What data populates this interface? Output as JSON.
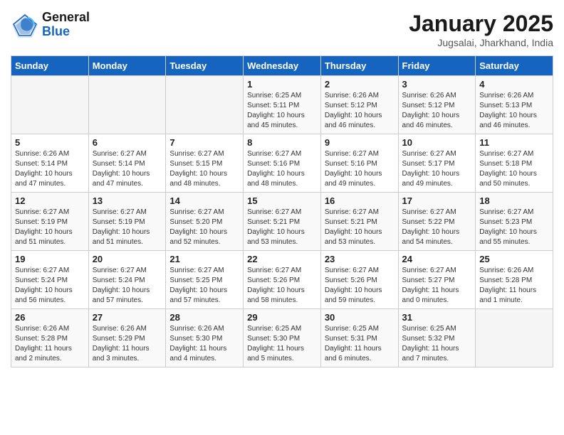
{
  "header": {
    "logo_line1": "General",
    "logo_line2": "Blue",
    "month": "January 2025",
    "location": "Jugsalai, Jharkhand, India"
  },
  "weekdays": [
    "Sunday",
    "Monday",
    "Tuesday",
    "Wednesday",
    "Thursday",
    "Friday",
    "Saturday"
  ],
  "weeks": [
    [
      {
        "day": "",
        "info": ""
      },
      {
        "day": "",
        "info": ""
      },
      {
        "day": "",
        "info": ""
      },
      {
        "day": "1",
        "info": "Sunrise: 6:25 AM\nSunset: 5:11 PM\nDaylight: 10 hours\nand 45 minutes."
      },
      {
        "day": "2",
        "info": "Sunrise: 6:26 AM\nSunset: 5:12 PM\nDaylight: 10 hours\nand 46 minutes."
      },
      {
        "day": "3",
        "info": "Sunrise: 6:26 AM\nSunset: 5:12 PM\nDaylight: 10 hours\nand 46 minutes."
      },
      {
        "day": "4",
        "info": "Sunrise: 6:26 AM\nSunset: 5:13 PM\nDaylight: 10 hours\nand 46 minutes."
      }
    ],
    [
      {
        "day": "5",
        "info": "Sunrise: 6:26 AM\nSunset: 5:14 PM\nDaylight: 10 hours\nand 47 minutes."
      },
      {
        "day": "6",
        "info": "Sunrise: 6:27 AM\nSunset: 5:14 PM\nDaylight: 10 hours\nand 47 minutes."
      },
      {
        "day": "7",
        "info": "Sunrise: 6:27 AM\nSunset: 5:15 PM\nDaylight: 10 hours\nand 48 minutes."
      },
      {
        "day": "8",
        "info": "Sunrise: 6:27 AM\nSunset: 5:16 PM\nDaylight: 10 hours\nand 48 minutes."
      },
      {
        "day": "9",
        "info": "Sunrise: 6:27 AM\nSunset: 5:16 PM\nDaylight: 10 hours\nand 49 minutes."
      },
      {
        "day": "10",
        "info": "Sunrise: 6:27 AM\nSunset: 5:17 PM\nDaylight: 10 hours\nand 49 minutes."
      },
      {
        "day": "11",
        "info": "Sunrise: 6:27 AM\nSunset: 5:18 PM\nDaylight: 10 hours\nand 50 minutes."
      }
    ],
    [
      {
        "day": "12",
        "info": "Sunrise: 6:27 AM\nSunset: 5:19 PM\nDaylight: 10 hours\nand 51 minutes."
      },
      {
        "day": "13",
        "info": "Sunrise: 6:27 AM\nSunset: 5:19 PM\nDaylight: 10 hours\nand 51 minutes."
      },
      {
        "day": "14",
        "info": "Sunrise: 6:27 AM\nSunset: 5:20 PM\nDaylight: 10 hours\nand 52 minutes."
      },
      {
        "day": "15",
        "info": "Sunrise: 6:27 AM\nSunset: 5:21 PM\nDaylight: 10 hours\nand 53 minutes."
      },
      {
        "day": "16",
        "info": "Sunrise: 6:27 AM\nSunset: 5:21 PM\nDaylight: 10 hours\nand 53 minutes."
      },
      {
        "day": "17",
        "info": "Sunrise: 6:27 AM\nSunset: 5:22 PM\nDaylight: 10 hours\nand 54 minutes."
      },
      {
        "day": "18",
        "info": "Sunrise: 6:27 AM\nSunset: 5:23 PM\nDaylight: 10 hours\nand 55 minutes."
      }
    ],
    [
      {
        "day": "19",
        "info": "Sunrise: 6:27 AM\nSunset: 5:24 PM\nDaylight: 10 hours\nand 56 minutes."
      },
      {
        "day": "20",
        "info": "Sunrise: 6:27 AM\nSunset: 5:24 PM\nDaylight: 10 hours\nand 57 minutes."
      },
      {
        "day": "21",
        "info": "Sunrise: 6:27 AM\nSunset: 5:25 PM\nDaylight: 10 hours\nand 57 minutes."
      },
      {
        "day": "22",
        "info": "Sunrise: 6:27 AM\nSunset: 5:26 PM\nDaylight: 10 hours\nand 58 minutes."
      },
      {
        "day": "23",
        "info": "Sunrise: 6:27 AM\nSunset: 5:26 PM\nDaylight: 10 hours\nand 59 minutes."
      },
      {
        "day": "24",
        "info": "Sunrise: 6:27 AM\nSunset: 5:27 PM\nDaylight: 11 hours\nand 0 minutes."
      },
      {
        "day": "25",
        "info": "Sunrise: 6:26 AM\nSunset: 5:28 PM\nDaylight: 11 hours\nand 1 minute."
      }
    ],
    [
      {
        "day": "26",
        "info": "Sunrise: 6:26 AM\nSunset: 5:28 PM\nDaylight: 11 hours\nand 2 minutes."
      },
      {
        "day": "27",
        "info": "Sunrise: 6:26 AM\nSunset: 5:29 PM\nDaylight: 11 hours\nand 3 minutes."
      },
      {
        "day": "28",
        "info": "Sunrise: 6:26 AM\nSunset: 5:30 PM\nDaylight: 11 hours\nand 4 minutes."
      },
      {
        "day": "29",
        "info": "Sunrise: 6:25 AM\nSunset: 5:30 PM\nDaylight: 11 hours\nand 5 minutes."
      },
      {
        "day": "30",
        "info": "Sunrise: 6:25 AM\nSunset: 5:31 PM\nDaylight: 11 hours\nand 6 minutes."
      },
      {
        "day": "31",
        "info": "Sunrise: 6:25 AM\nSunset: 5:32 PM\nDaylight: 11 hours\nand 7 minutes."
      },
      {
        "day": "",
        "info": ""
      }
    ]
  ]
}
